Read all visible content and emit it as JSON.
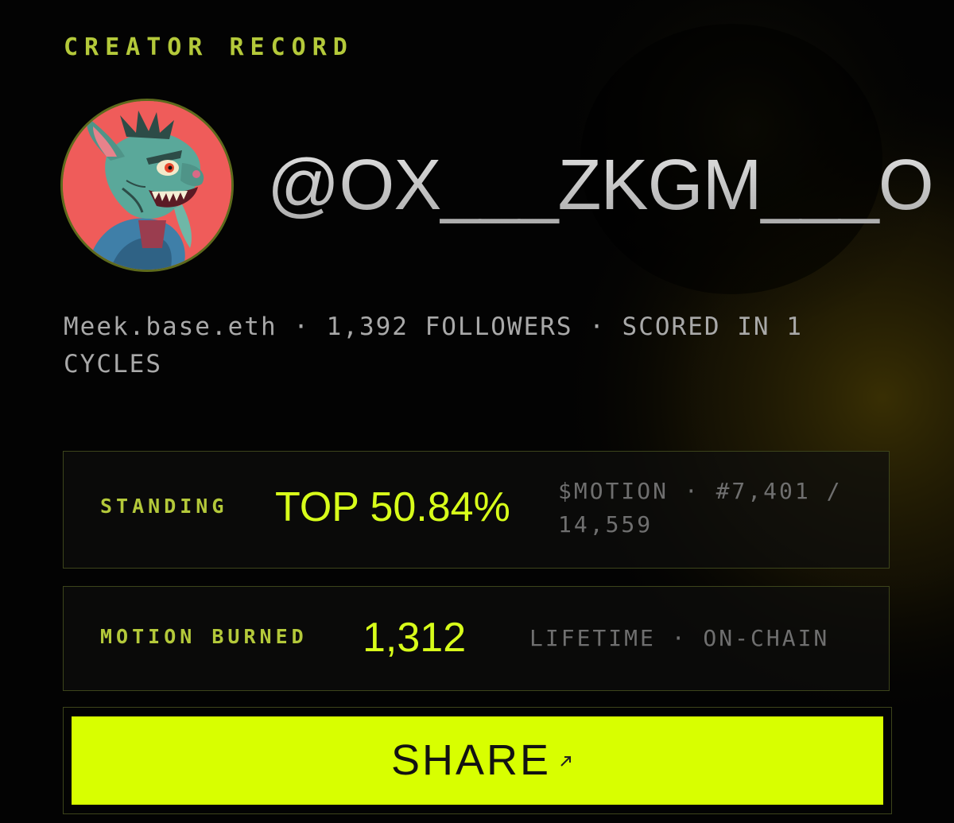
{
  "header": {
    "eyebrow": "CREATOR RECORD"
  },
  "profile": {
    "handle": "@OX___ZKGM___O",
    "meta": "Meek.base.eth · 1,392 FOLLOWERS · SCORED IN 1 CYCLES",
    "avatar_icon": "goblin-avatar"
  },
  "standing": {
    "label": "STANDING",
    "value": "TOP 50.84%",
    "note": "$MOTION · #7,401 / 14,559"
  },
  "burned": {
    "label": "MOTION BURNED",
    "value": "1,312",
    "note": "LIFETIME · ON-CHAIN"
  },
  "share": {
    "label": "SHARE",
    "icon": "arrow-up-right-icon"
  },
  "colors": {
    "accent": "#d8ff00",
    "label": "#b4c93a",
    "background": "#030303",
    "muted": "#a9a9a9"
  }
}
